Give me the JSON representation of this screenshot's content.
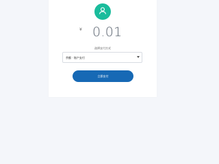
{
  "payment": {
    "avatar_icon": "user-icon",
    "accent_color": "#1abc9c",
    "currency_symbol": "¥",
    "amount": "0.01",
    "select_label": "选择支付方式",
    "selected_option": "余额 · 账户支付",
    "confirm_label": "立即支付",
    "button_color": "#1769b5"
  }
}
